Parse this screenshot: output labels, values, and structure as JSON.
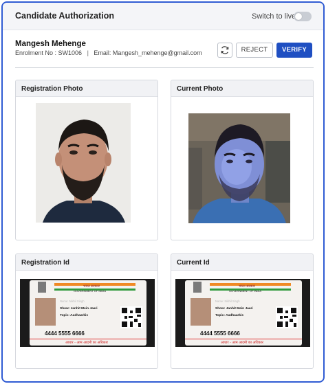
{
  "header": {
    "title": "Candidate Authorization",
    "live_toggle_label": "Switch to live",
    "live_toggle_on": false
  },
  "candidate": {
    "name": "Mangesh Mehenge",
    "enrolment": "Enrolment No : SW1006",
    "separator": "|",
    "email": "Email: Mangesh_mehenge@gmail.com"
  },
  "actions": {
    "refresh_icon": "refresh-icon",
    "reject_label": "REJECT",
    "verify_label": "VERIFY"
  },
  "cards": {
    "registration_photo": "Registration Photo",
    "current_photo": "Current Photo",
    "registration_id": "Registration Id",
    "current_id": "Current Id"
  },
  "id_card": {
    "hindi_gov": "भारत सरकार",
    "english_gov": "GOVERNMENT OF INDIA",
    "name_line": "Name: Nikhil Singh",
    "show_line": "Show: Janhit Mein Jaari",
    "topic_line": "Topic: Aadhaarkis",
    "number": "4444  5555  6666",
    "tagline": "आधार - आम आदमी का अधिकार"
  },
  "colors": {
    "accent": "#1f4fc2",
    "frame_border": "#2f5bd3",
    "header_bg": "#f4f5f8"
  }
}
